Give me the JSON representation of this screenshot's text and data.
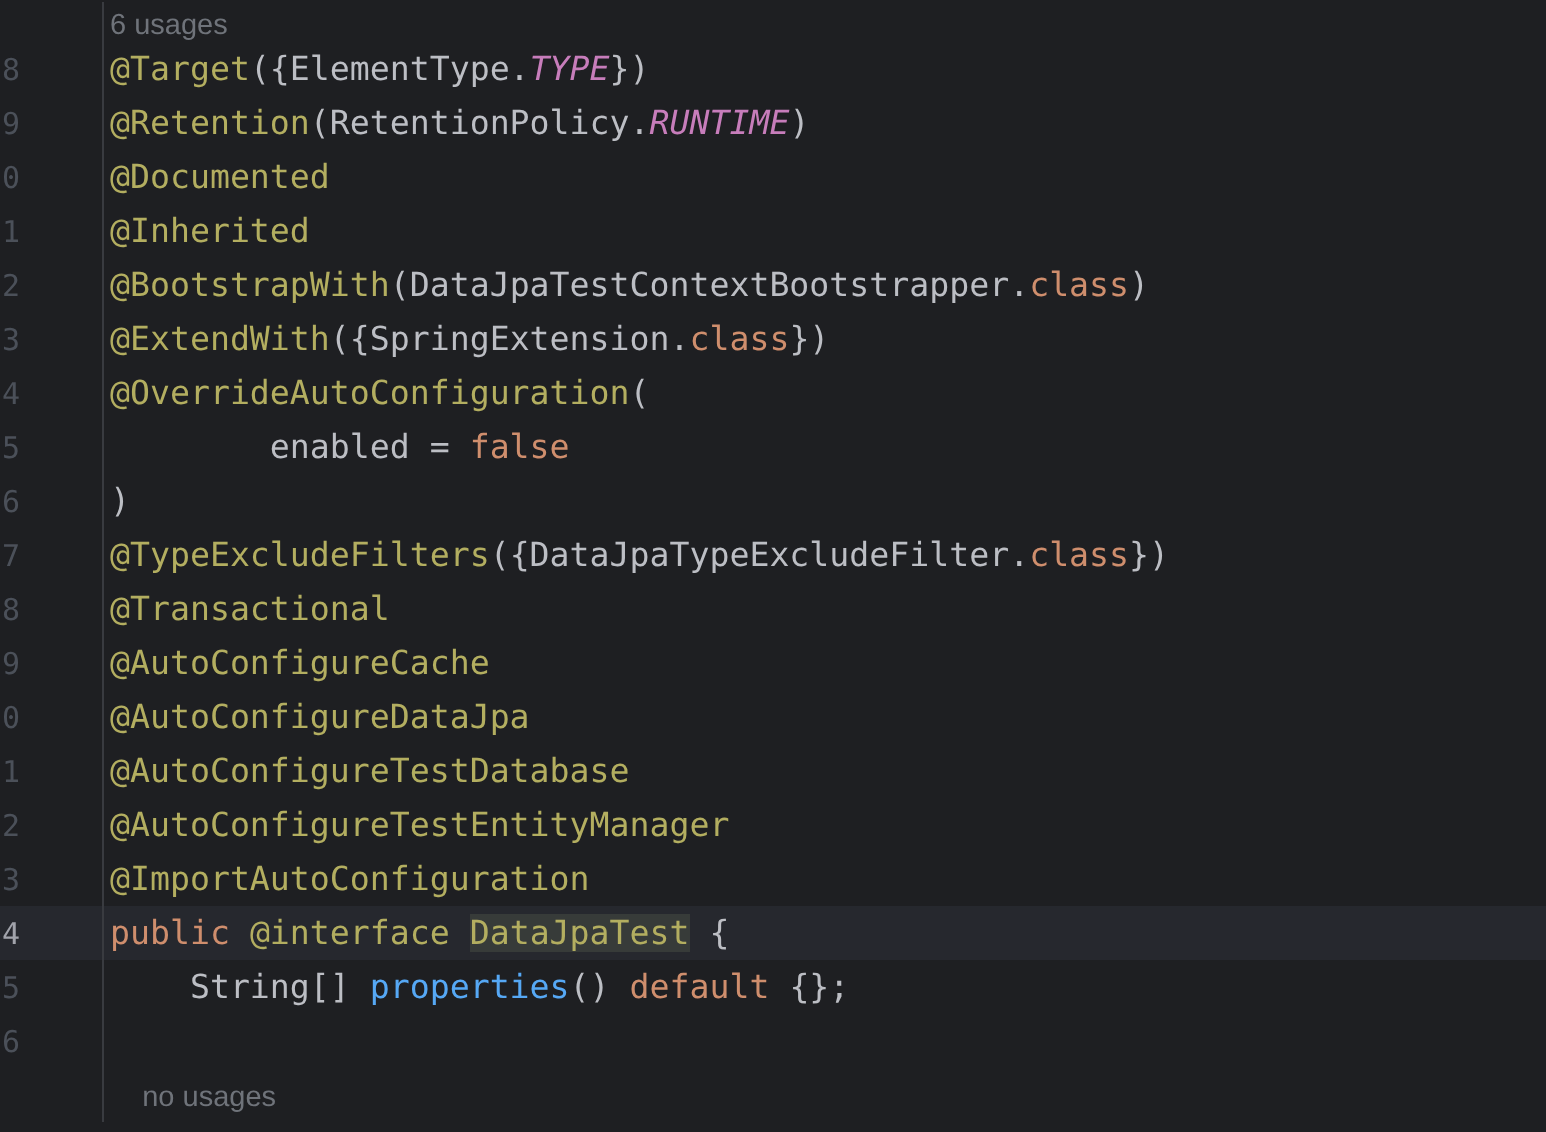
{
  "editor": {
    "lines": [
      {
        "kind": "hint",
        "text": "6 usages"
      },
      {
        "kind": "code",
        "number": "8",
        "current": false,
        "tokens": [
          {
            "kind": "annotation",
            "text": "@Target"
          },
          {
            "kind": "plain",
            "text": "({ElementType."
          },
          {
            "kind": "constant",
            "text": "TYPE"
          },
          {
            "kind": "plain",
            "text": "})"
          }
        ]
      },
      {
        "kind": "code",
        "number": "9",
        "current": false,
        "tokens": [
          {
            "kind": "annotation",
            "text": "@Retention"
          },
          {
            "kind": "plain",
            "text": "(RetentionPolicy."
          },
          {
            "kind": "constant",
            "text": "RUNTIME"
          },
          {
            "kind": "plain",
            "text": ")"
          }
        ]
      },
      {
        "kind": "code",
        "number": "0",
        "current": false,
        "tokens": [
          {
            "kind": "annotation",
            "text": "@Documented"
          }
        ]
      },
      {
        "kind": "code",
        "number": "1",
        "current": false,
        "tokens": [
          {
            "kind": "annotation",
            "text": "@Inherited"
          }
        ]
      },
      {
        "kind": "code",
        "number": "2",
        "current": false,
        "tokens": [
          {
            "kind": "annotation",
            "text": "@BootstrapWith"
          },
          {
            "kind": "plain",
            "text": "(DataJpaTestContextBootstrapper."
          },
          {
            "kind": "keyword",
            "text": "class"
          },
          {
            "kind": "plain",
            "text": ")"
          }
        ]
      },
      {
        "kind": "code",
        "number": "3",
        "current": false,
        "tokens": [
          {
            "kind": "annotation",
            "text": "@ExtendWith"
          },
          {
            "kind": "plain",
            "text": "({SpringExtension."
          },
          {
            "kind": "keyword",
            "text": "class"
          },
          {
            "kind": "plain",
            "text": "})"
          }
        ]
      },
      {
        "kind": "code",
        "number": "4",
        "current": false,
        "tokens": [
          {
            "kind": "annotation",
            "text": "@OverrideAutoConfiguration"
          },
          {
            "kind": "plain",
            "text": "("
          }
        ]
      },
      {
        "kind": "code",
        "number": "5",
        "current": false,
        "tokens": [
          {
            "kind": "plain",
            "text": "        enabled = "
          },
          {
            "kind": "keyword",
            "text": "false"
          }
        ]
      },
      {
        "kind": "code",
        "number": "6",
        "current": false,
        "tokens": [
          {
            "kind": "plain",
            "text": ")"
          }
        ]
      },
      {
        "kind": "code",
        "number": "7",
        "current": false,
        "tokens": [
          {
            "kind": "annotation",
            "text": "@TypeExcludeFilters"
          },
          {
            "kind": "plain",
            "text": "({DataJpaTypeExcludeFilter."
          },
          {
            "kind": "keyword",
            "text": "class"
          },
          {
            "kind": "plain",
            "text": "})"
          }
        ]
      },
      {
        "kind": "code",
        "number": "8",
        "current": false,
        "tokens": [
          {
            "kind": "annotation",
            "text": "@Transactional"
          }
        ]
      },
      {
        "kind": "code",
        "number": "9",
        "current": false,
        "tokens": [
          {
            "kind": "annotation",
            "text": "@AutoConfigureCache"
          }
        ]
      },
      {
        "kind": "code",
        "number": "0",
        "current": false,
        "tokens": [
          {
            "kind": "annotation",
            "text": "@AutoConfigureDataJpa"
          }
        ]
      },
      {
        "kind": "code",
        "number": "1",
        "current": false,
        "tokens": [
          {
            "kind": "annotation",
            "text": "@AutoConfigureTestDatabase"
          }
        ]
      },
      {
        "kind": "code",
        "number": "2",
        "current": false,
        "tokens": [
          {
            "kind": "annotation",
            "text": "@AutoConfigureTestEntityManager"
          }
        ]
      },
      {
        "kind": "code",
        "number": "3",
        "current": false,
        "tokens": [
          {
            "kind": "annotation",
            "text": "@ImportAutoConfiguration"
          }
        ]
      },
      {
        "kind": "code",
        "number": "4",
        "current": true,
        "tokens": [
          {
            "kind": "keyword",
            "text": "public "
          },
          {
            "kind": "annotation",
            "text": "@interface "
          },
          {
            "kind": "highlight",
            "text": "DataJpaTest"
          },
          {
            "kind": "plain",
            "text": " {"
          }
        ]
      },
      {
        "kind": "code",
        "number": "5",
        "current": false,
        "tokens": [
          {
            "kind": "plain",
            "text": "    String[] "
          },
          {
            "kind": "method",
            "text": "properties"
          },
          {
            "kind": "plain",
            "text": "() "
          },
          {
            "kind": "keyword",
            "text": "default"
          },
          {
            "kind": "plain",
            "text": " {};"
          }
        ]
      },
      {
        "kind": "code",
        "number": "6",
        "current": false
      },
      {
        "kind": "hint",
        "text": "    no usages"
      }
    ]
  }
}
